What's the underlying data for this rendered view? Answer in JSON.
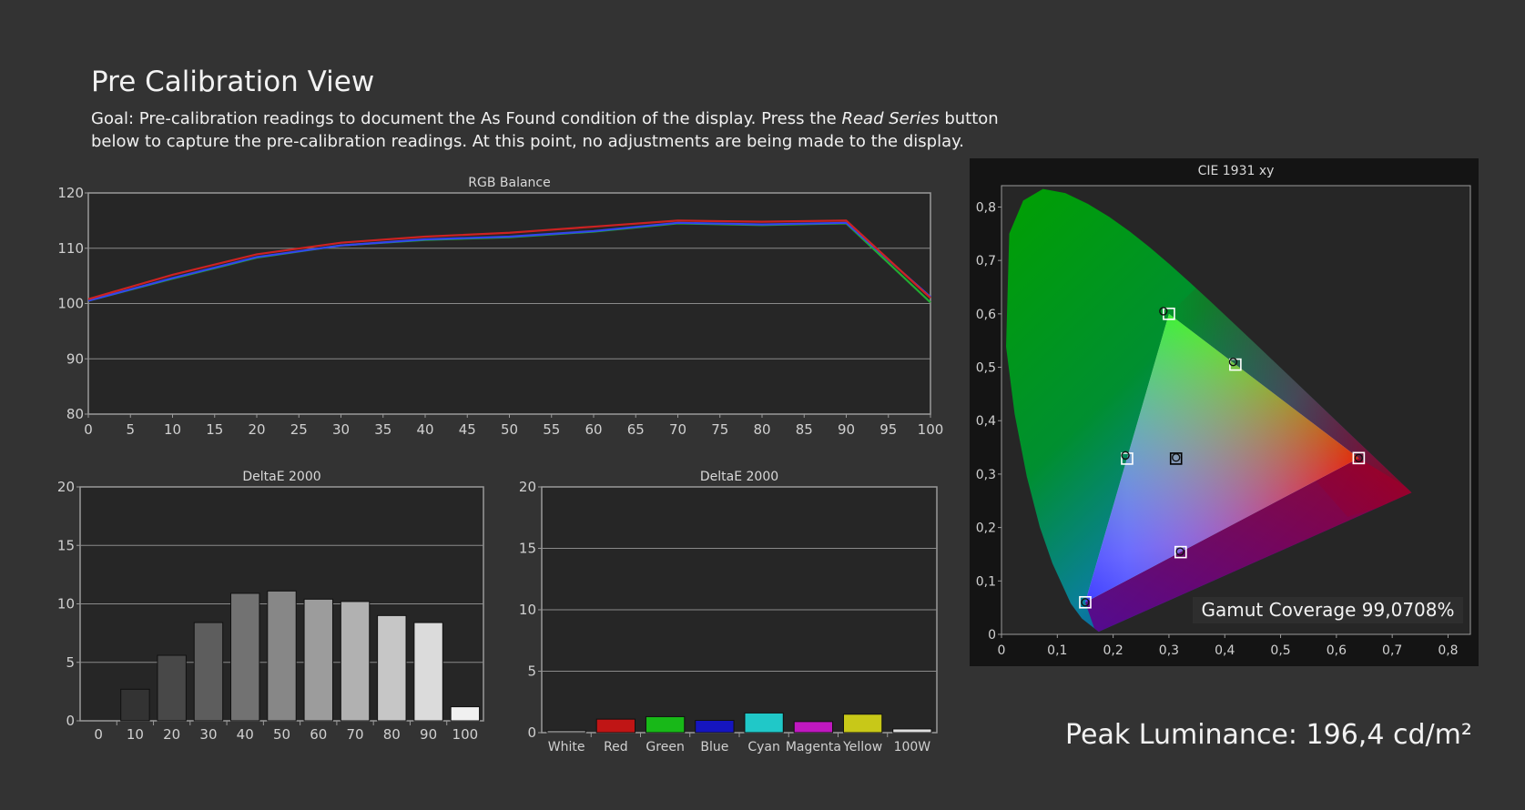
{
  "page": {
    "title": "Pre Calibration View",
    "goal_prefix": "Goal: Pre-calibration readings to document the As Found condition of the display. Press the ",
    "goal_italic": "Read Series",
    "goal_suffix": " button below to capture the pre-calibration readings. At this point, no adjustments are being made to the display.",
    "gamut_coverage": "Gamut Coverage 99,0708%",
    "peak_luminance": "Peak Luminance: 196,4 cd/m²"
  },
  "colors": {
    "background": "#333333",
    "plot_bg": "#262626",
    "red": "#cc2222",
    "green": "#22aa33",
    "blue": "#3344ee"
  },
  "chart_data": [
    {
      "id": "rgb_balance",
      "type": "line",
      "title": "RGB Balance",
      "x": [
        0,
        10,
        20,
        30,
        40,
        50,
        60,
        70,
        80,
        90,
        100
      ],
      "xticks": [
        0,
        5,
        10,
        15,
        20,
        25,
        30,
        35,
        40,
        45,
        50,
        55,
        60,
        65,
        70,
        75,
        80,
        85,
        90,
        95,
        100
      ],
      "yticks": [
        80,
        90,
        100,
        110,
        120
      ],
      "xlim": [
        0,
        100
      ],
      "ylim": [
        80,
        120
      ],
      "grid": true,
      "series": [
        {
          "color": "#22aa33",
          "values": [
            100.5,
            104.5,
            108.3,
            110.5,
            111.5,
            112.0,
            113.0,
            114.5,
            114.2,
            114.5,
            100.2
          ]
        },
        {
          "color": "#3344ee",
          "values": [
            100.5,
            104.6,
            108.4,
            110.5,
            111.6,
            112.1,
            113.1,
            114.6,
            114.3,
            114.6,
            101.2
          ]
        },
        {
          "color": "#cc2222",
          "values": [
            100.8,
            105.2,
            108.9,
            111.0,
            112.1,
            112.8,
            113.9,
            115.0,
            114.8,
            115.0,
            101.0
          ]
        }
      ]
    },
    {
      "id": "grayscale_de",
      "type": "bar",
      "title": "DeltaE 2000",
      "categories": [
        "0",
        "10",
        "20",
        "30",
        "40",
        "50",
        "60",
        "70",
        "80",
        "90",
        "100"
      ],
      "values": [
        0,
        2.7,
        5.6,
        8.4,
        10.9,
        11.1,
        10.4,
        10.2,
        9.0,
        8.4,
        1.2
      ],
      "yticks": [
        0,
        5,
        10,
        15,
        20
      ],
      "ylim": [
        0,
        20
      ],
      "grid": true
    },
    {
      "id": "color_de",
      "type": "bar",
      "title": "DeltaE 2000",
      "categories": [
        "White",
        "Red",
        "Green",
        "Blue",
        "Cyan",
        "Magenta",
        "Yellow",
        "100W"
      ],
      "values": [
        0.15,
        1.1,
        1.3,
        1.0,
        1.6,
        0.9,
        1.5,
        0.3
      ],
      "bar_colors": [
        "#d0d0d0",
        "#c01515",
        "#18b818",
        "#1515c0",
        "#20c8c8",
        "#c018c0",
        "#c8c818",
        "#e0e0e0"
      ],
      "yticks": [
        0,
        5,
        10,
        15,
        20
      ],
      "ylim": [
        0,
        20
      ],
      "grid": true
    },
    {
      "id": "cie",
      "type": "scatter",
      "title": "CIE 1931 xy",
      "xticks": [
        "0",
        "0,1",
        "0,2",
        "0,3",
        "0,4",
        "0,5",
        "0,6",
        "0,7",
        "0,8"
      ],
      "yticks": [
        "0",
        "0,1",
        "0,2",
        "0,3",
        "0,4",
        "0,5",
        "0,6",
        "0,7",
        "0,8"
      ],
      "xlim": [
        0,
        0.84
      ],
      "ylim": [
        0,
        0.84
      ],
      "targets": [
        {
          "name": "Red",
          "x": 0.64,
          "y": 0.33
        },
        {
          "name": "Green",
          "x": 0.3,
          "y": 0.6
        },
        {
          "name": "Blue",
          "x": 0.15,
          "y": 0.06
        },
        {
          "name": "Cyan",
          "x": 0.225,
          "y": 0.329
        },
        {
          "name": "Magenta",
          "x": 0.321,
          "y": 0.154
        },
        {
          "name": "Yellow",
          "x": 0.419,
          "y": 0.505
        },
        {
          "name": "White",
          "x": 0.3127,
          "y": 0.329
        }
      ],
      "measured": [
        {
          "name": "Red",
          "x": 0.64,
          "y": 0.33
        },
        {
          "name": "Green",
          "x": 0.29,
          "y": 0.605
        },
        {
          "name": "Blue",
          "x": 0.15,
          "y": 0.06
        },
        {
          "name": "Cyan",
          "x": 0.222,
          "y": 0.335
        },
        {
          "name": "Magenta",
          "x": 0.32,
          "y": 0.155
        },
        {
          "name": "Yellow",
          "x": 0.415,
          "y": 0.51
        },
        {
          "name": "White",
          "x": 0.3127,
          "y": 0.331
        }
      ]
    }
  ]
}
